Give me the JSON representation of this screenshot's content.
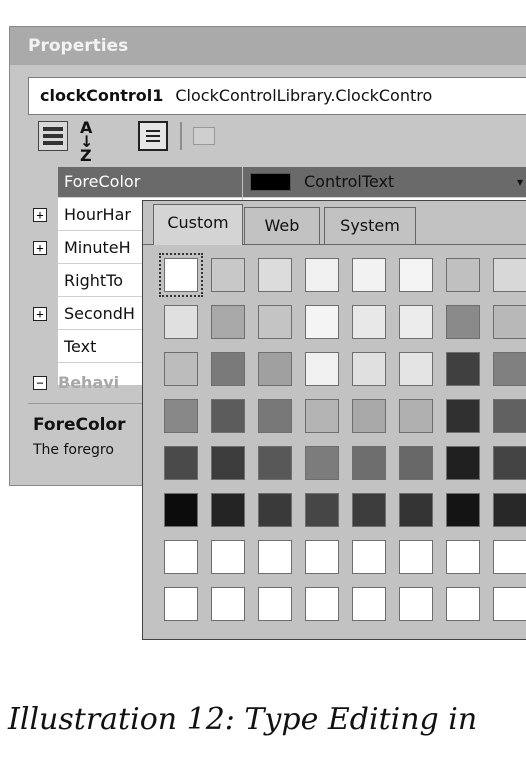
{
  "window": {
    "title": "Properties",
    "object_name": "clockControl1",
    "object_type": "ClockControlLibrary.ClockContro"
  },
  "toolbar": {
    "sort_alpha_label": "A↓Z",
    "icons": [
      "categorized-icon",
      "alphabetical-icon",
      "properties-icon",
      "property-pages-icon"
    ]
  },
  "grid": {
    "rows": [
      {
        "name": "ForeColor",
        "expandable": false,
        "selected": true
      },
      {
        "name": "HourHar",
        "expandable": true,
        "selected": false
      },
      {
        "name": "MinuteH",
        "expandable": true,
        "selected": false
      },
      {
        "name": "RightTo",
        "expandable": false,
        "selected": false
      },
      {
        "name": "SecondH",
        "expandable": true,
        "selected": false
      },
      {
        "name": "Text",
        "expandable": false,
        "selected": false
      }
    ],
    "selected_value": "ControlText",
    "category": "Behavi",
    "expand_glyph": "+",
    "collapse_glyph": "−",
    "dropdown_glyph": "▾"
  },
  "description": {
    "title": "ForeColor",
    "text": "The foregro"
  },
  "color_picker": {
    "tabs": [
      "Custom",
      "Web",
      "System"
    ],
    "active_tab": "Custom",
    "selected_cell": 0,
    "palette": [
      [
        "#ffffff",
        "#c8c8c8",
        "#dcdcdc",
        "#f0f0f0",
        "#f2f2f2",
        "#f4f4f4",
        "#c0c0c0",
        "#d8d8d8"
      ],
      [
        "#e0e0e0",
        "#a8a8a8",
        "#c4c4c4",
        "#f4f4f4",
        "#e8e8e8",
        "#ececec",
        "#8a8a8a",
        "#b8b8b8"
      ],
      [
        "#bcbcbc",
        "#7a7a7a",
        "#a0a0a0",
        "#f0f0f0",
        "#e0e0e0",
        "#e4e4e4",
        "#404040",
        "#808080"
      ],
      [
        "#888888",
        "#5c5c5c",
        "#787878",
        "#b4b4b4",
        "#a8a8a8",
        "#b0b0b0",
        "#303030",
        "#606060"
      ],
      [
        "#4a4a4a",
        "#3c3c3c",
        "#585858",
        "#7c7c7c",
        "#6e6e6e",
        "#686868",
        "#202020",
        "#444444"
      ],
      [
        "#0c0c0c",
        "#242424",
        "#3a3a3a",
        "#464646",
        "#3c3c3c",
        "#343434",
        "#141414",
        "#282828"
      ],
      [
        "#ffffff",
        "#ffffff",
        "#ffffff",
        "#ffffff",
        "#ffffff",
        "#ffffff",
        "#ffffff",
        "#ffffff"
      ],
      [
        "#ffffff",
        "#ffffff",
        "#ffffff",
        "#ffffff",
        "#ffffff",
        "#ffffff",
        "#ffffff",
        "#ffffff"
      ]
    ]
  },
  "caption": "Illustration 12: Type Editing in"
}
